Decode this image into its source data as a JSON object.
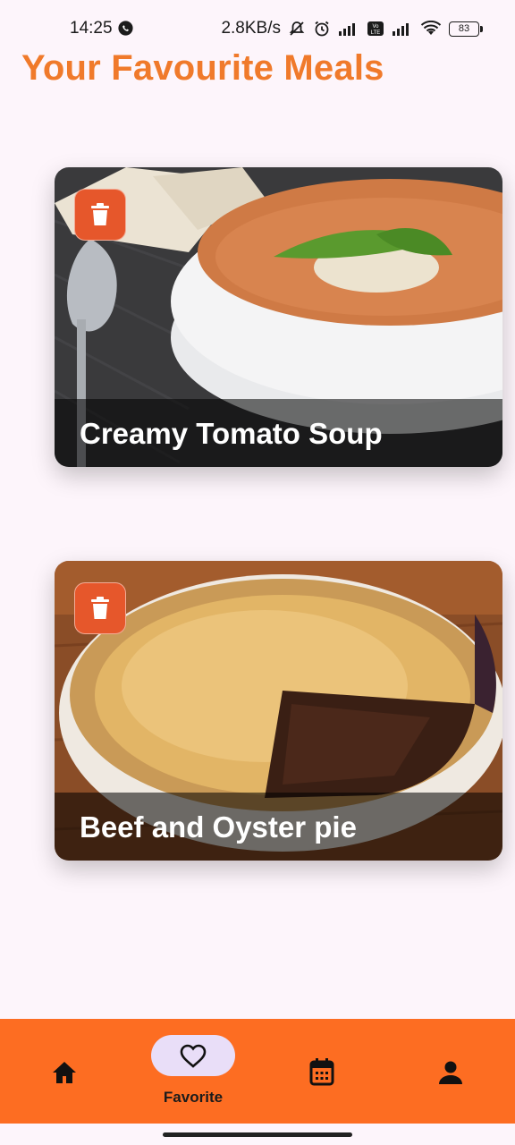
{
  "status_bar": {
    "time": "14:25",
    "network_speed": "2.8KB/s",
    "battery": "83",
    "icons": [
      "whatsapp-icon",
      "mute-icon",
      "alarm-icon",
      "signal-icon",
      "volte-icon",
      "signal-icon",
      "wifi-icon",
      "battery-icon"
    ]
  },
  "page": {
    "title": "Your Favourite Meals",
    "title_color": "#f07a2b",
    "background": "#fdf5fb"
  },
  "meals": [
    {
      "name": "Creamy Tomato Soup",
      "image": "tomato-soup-photo",
      "delete_icon": "trash-icon"
    },
    {
      "name": "Beef and Oyster pie",
      "image": "beef-pie-photo",
      "delete_icon": "trash-icon"
    }
  ],
  "bottom_nav": {
    "color": "#fd6d22",
    "items": [
      {
        "icon": "home-icon",
        "label": ""
      },
      {
        "icon": "heart-icon",
        "label": "Favorite",
        "selected": true
      },
      {
        "icon": "calendar-icon",
        "label": ""
      },
      {
        "icon": "person-icon",
        "label": ""
      }
    ]
  }
}
